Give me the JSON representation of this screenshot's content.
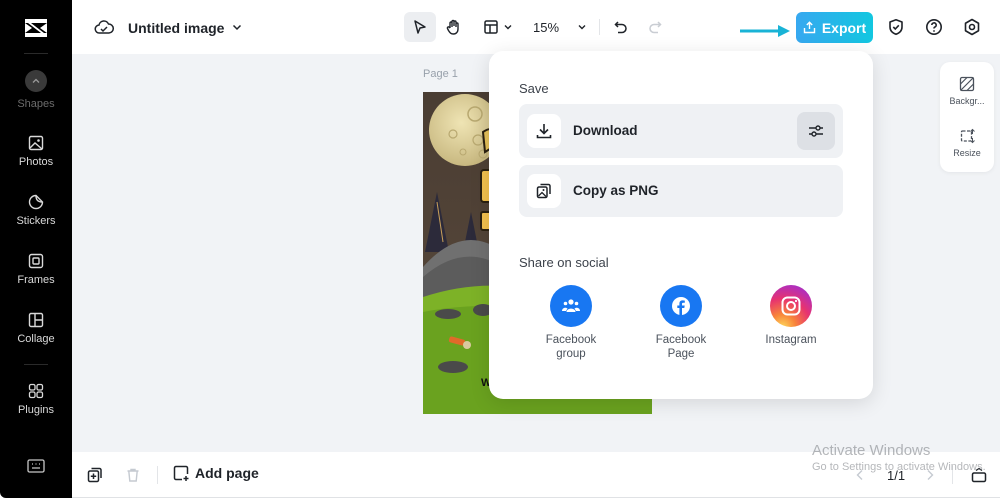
{
  "sidebar": {
    "items": [
      {
        "label": "Shapes"
      },
      {
        "label": "Photos"
      },
      {
        "label": "Stickers"
      },
      {
        "label": "Frames"
      },
      {
        "label": "Collage"
      },
      {
        "label": "Plugins"
      }
    ]
  },
  "header": {
    "title": "Untitled image",
    "zoom": "15%",
    "export_label": "Export"
  },
  "canvas": {
    "page_label": "Page 1"
  },
  "right_panel": {
    "items": [
      {
        "label": "Backgr..."
      },
      {
        "label": "Resize"
      }
    ]
  },
  "export_menu": {
    "save_heading": "Save",
    "download_label": "Download",
    "copy_label": "Copy as PNG",
    "share_heading": "Share on social",
    "social": [
      {
        "line1": "Facebook",
        "line2": "group"
      },
      {
        "line1": "Facebook",
        "line2": "Page"
      },
      {
        "line1": "Instagram",
        "line2": ""
      }
    ]
  },
  "bottombar": {
    "add_page_label": "Add page",
    "pager": "1/1"
  },
  "watermark": {
    "title": "Activate Windows",
    "subtitle": "Go to Settings to activate Windows."
  },
  "colors": {
    "export_gradient_start": "#37a8f0",
    "export_gradient_end": "#12c7e0",
    "facebook_blue": "#1877f2",
    "annotation_arrow": "#19b3d6"
  }
}
